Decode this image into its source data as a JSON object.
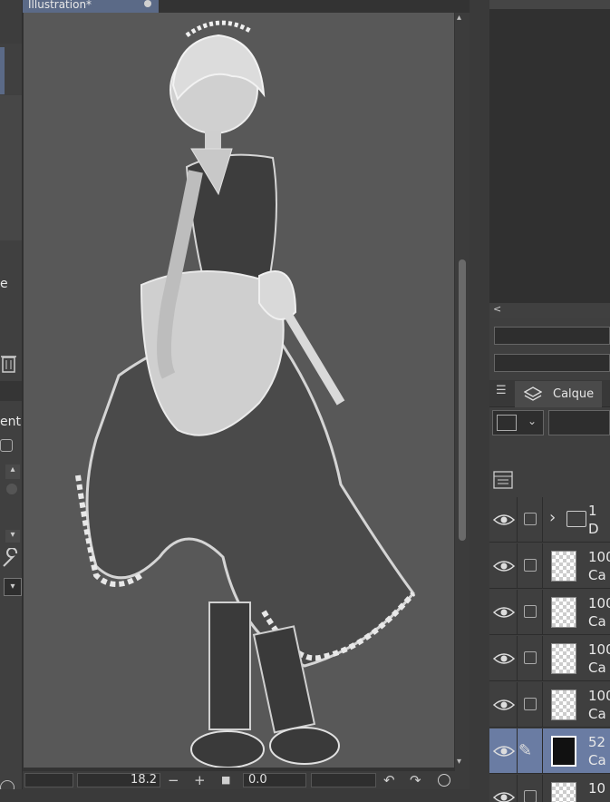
{
  "document": {
    "tab_label": "Illustration*"
  },
  "left_panel": {
    "label_top": "e",
    "label_mid": "ent"
  },
  "status_bar": {
    "zoom": "18.2",
    "minus": "−",
    "plus": "+",
    "stop": "■",
    "angle": "0.0",
    "rotate_left": "↶",
    "rotate_right": "↷"
  },
  "scrollbar": {
    "up": "▴",
    "down": "▾"
  },
  "navigator": {
    "collapse_arrow": "<"
  },
  "layers_panel": {
    "tab_label": "Calque",
    "menu_icon": "☰",
    "layers": [
      {
        "type": "folder",
        "opacity": "1",
        "name": "D",
        "chevron": "›"
      },
      {
        "type": "raster",
        "opacity": "100",
        "name": "Ca"
      },
      {
        "type": "raster",
        "opacity": "100",
        "name": "Ca"
      },
      {
        "type": "raster",
        "opacity": "100",
        "name": "Ca"
      },
      {
        "type": "raster",
        "opacity": "100",
        "name": "Ca"
      },
      {
        "type": "raster",
        "opacity": "52",
        "name": "Ca",
        "selected": true,
        "pen": "✎"
      },
      {
        "type": "raster",
        "opacity": "10",
        "name": ""
      }
    ]
  },
  "colors": {
    "canvas": "#585858",
    "selected_layer": "#6a7ca3",
    "doc_tab": "#5b6a87",
    "panel": "#3f3f3f"
  }
}
